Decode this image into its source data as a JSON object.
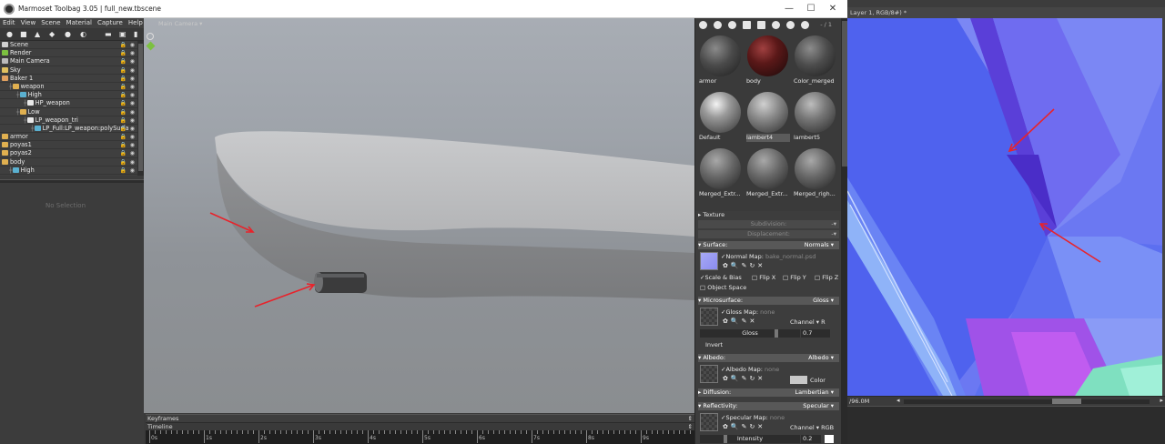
{
  "marmoset": {
    "title": "Marmoset Toolbag 3.05  |  full_new.tbscene",
    "window_controls": [
      "—",
      "☐",
      "✕"
    ],
    "menu": [
      "Edit",
      "View",
      "Scene",
      "Material",
      "Capture",
      "Help"
    ],
    "outliner": [
      {
        "label": "Scene",
        "indent": 0,
        "icon": "scene-icon",
        "color": "#d0d0d0"
      },
      {
        "label": "Render",
        "indent": 0,
        "icon": "render-icon",
        "color": "#7cc040"
      },
      {
        "label": "Main Camera",
        "indent": 0,
        "icon": "camera-icon",
        "color": "#bbbbbb"
      },
      {
        "label": "Sky",
        "indent": 0,
        "icon": "sky-icon",
        "color": "#e0c060"
      },
      {
        "label": "Baker 1",
        "indent": 0,
        "icon": "baker-icon",
        "color": "#e0a060"
      },
      {
        "label": "weapon",
        "indent": 1,
        "icon": "folder-icon",
        "color": "#e0b050"
      },
      {
        "label": "High",
        "indent": 2,
        "icon": "group-icon",
        "color": "#5ab0d0"
      },
      {
        "label": "HP_weapon",
        "indent": 3,
        "icon": "mesh-icon",
        "color": "#e8e8e8"
      },
      {
        "label": "Low",
        "indent": 2,
        "icon": "group-icon",
        "color": "#e0b050"
      },
      {
        "label": "LP_weapon_tri",
        "indent": 3,
        "icon": "mesh-icon",
        "color": "#e8e8e8"
      },
      {
        "label": "LP_Full:LP_weapon:polySurfa",
        "indent": 4,
        "icon": "submesh-icon",
        "color": "#5ab0d0"
      },
      {
        "label": "armor",
        "indent": 0,
        "icon": "folder-icon",
        "color": "#e0b050"
      },
      {
        "label": "poyas1",
        "indent": 0,
        "icon": "folder-icon",
        "color": "#e0b050"
      },
      {
        "label": "poyas2",
        "indent": 0,
        "icon": "folder-icon",
        "color": "#e0b050"
      },
      {
        "label": "body",
        "indent": 0,
        "icon": "folder-icon",
        "color": "#e0b050"
      },
      {
        "label": "High",
        "indent": 1,
        "icon": "group-icon",
        "color": "#5ab0d0"
      }
    ],
    "no_selection": "No Selection",
    "viewport_camera": "Main Camera",
    "keyframes_label": "Keyframes",
    "timeline_label": "Timeline",
    "timeline_ticks": [
      "0s",
      "1s",
      "2s",
      "3s",
      "4s",
      "5s",
      "6s",
      "7s",
      "8s",
      "9s"
    ]
  },
  "materials": {
    "count_label": "- / 1",
    "swatches": [
      {
        "name": "armor",
        "ball": "radial-gradient(circle at 38% 32%, #8a8a8a 0%, #4a4a4a 45%, #1e1e1e 100%)",
        "selected": false
      },
      {
        "name": "body",
        "ball": "radial-gradient(circle at 38% 32%, #a04040 0%, #5a1818 40%, #1a0a0a 100%)",
        "selected": false
      },
      {
        "name": "Color_merged",
        "ball": "radial-gradient(circle at 38% 32%, #8c8c8c 0%, #4c4c4c 45%, #1c1c1c 100%)",
        "selected": false
      },
      {
        "name": "Default",
        "ball": "radial-gradient(circle at 40% 30%, #f4f4f4 0%, #9a9a9a 35%, #303030 100%)",
        "selected": false
      },
      {
        "name": "lambert4",
        "ball": "radial-gradient(circle at 40% 30%, #d0d0d0 0%, #8a8a8a 40%, #2a2a2a 100%)",
        "selected": true
      },
      {
        "name": "lambert5",
        "ball": "radial-gradient(circle at 40% 30%, #bdbdbd 0%, #777 40%, #262626 100%)",
        "selected": false
      },
      {
        "name": "Merged_Extr...",
        "ball": "radial-gradient(circle at 40% 30%, #a8a8a8 0%, #666 45%, #222 100%)",
        "selected": false
      },
      {
        "name": "Merged_Extr...",
        "ball": "radial-gradient(circle at 40% 30%, #a8a8a8 0%, #666 45%, #222 100%)",
        "selected": false
      },
      {
        "name": "Merged_righ...",
        "ball": "radial-gradient(circle at 40% 30%, #a8a8a8 0%, #666 45%, #222 100%)",
        "selected": false
      }
    ],
    "texture_label": "Texture",
    "subdivision_label": "Subdivision:",
    "displacement_label": "Displacement:",
    "surface": {
      "label": "Surface:",
      "value": "Normals"
    },
    "normal_map": {
      "label": "Normal Map:",
      "value": "bake_normal.psd"
    },
    "scale_bias": "Scale & Bias",
    "flip_x": "Flip X",
    "flip_y": "Flip Y",
    "flip_z": "Flip Z",
    "object_space": "Object Space",
    "microsurface": {
      "label": "Microsurface:",
      "value": "Gloss"
    },
    "gloss_map": {
      "label": "Gloss Map:",
      "value": "none"
    },
    "gloss_channel": "Channel ▾ R",
    "gloss_slider": {
      "label": "Gloss",
      "value": "0.7"
    },
    "invert": "Invert",
    "albedo": {
      "label": "Albedo:",
      "value": "Albedo"
    },
    "albedo_map": {
      "label": "Albedo Map:",
      "value": "none"
    },
    "albedo_color": "Color",
    "diffusion": {
      "label": "Diffusion:",
      "value": "Lambertian"
    },
    "reflectivity": {
      "label": "Reflectivity:",
      "value": "Specular"
    },
    "specular_map": {
      "label": "Specular Map:",
      "value": "none"
    },
    "specular_channel": "Channel ▾ RGB",
    "intensity_slider": {
      "label": "Intensity",
      "value": "0.2"
    }
  },
  "editor": {
    "tab_title": "Layer 1, RGB/8#) *",
    "zoom": "96.0M"
  }
}
